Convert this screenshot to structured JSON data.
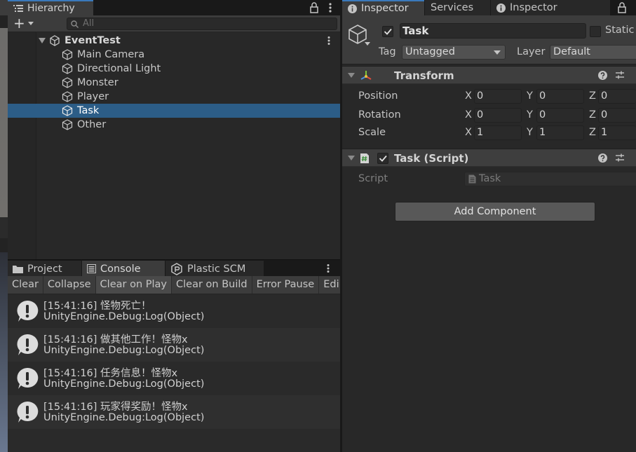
{
  "hierarchy": {
    "tab_title": "Hierarchy",
    "add_button": "+",
    "search_placeholder": "All",
    "scene_name": "EventTest",
    "objects": [
      {
        "name": "Main Camera"
      },
      {
        "name": "Directional Light"
      },
      {
        "name": "Monster"
      },
      {
        "name": "Player"
      },
      {
        "name": "Task",
        "selected": true
      },
      {
        "name": "Other"
      }
    ]
  },
  "console": {
    "tabs": [
      "Project",
      "Console",
      "Plastic SCM"
    ],
    "active_tab": "Console",
    "toolbar": [
      "Clear",
      "Collapse",
      "Clear on Play",
      "Clear on Build",
      "Error Pause",
      "Edi"
    ],
    "toolbar_active": "Clear on Play",
    "logs": [
      {
        "line1": "[15:41:16] 怪物死亡！",
        "line2": "UnityEngine.Debug:Log(Object)"
      },
      {
        "line1": "[15:41:16] 做其他工作！怪物x",
        "line2": "UnityEngine.Debug:Log(Object)"
      },
      {
        "line1": "[15:41:16] 任务信息！怪物x",
        "line2": "UnityEngine.Debug:Log(Object)"
      },
      {
        "line1": "[15:41:16] 玩家得奖励！怪物x",
        "line2": "UnityEngine.Debug:Log(Object)"
      }
    ]
  },
  "inspector": {
    "tabs": [
      "Inspector",
      "Services",
      "Inspector"
    ],
    "object_name": "Task",
    "active": true,
    "static_label": "Static",
    "tag_label": "Tag",
    "tag_value": "Untagged",
    "layer_label": "Layer",
    "layer_value": "Default",
    "transform": {
      "title": "Transform",
      "rows": [
        {
          "label": "Position",
          "x": "0",
          "y": "0",
          "z": "0"
        },
        {
          "label": "Rotation",
          "x": "0",
          "y": "0",
          "z": "0"
        },
        {
          "label": "Scale",
          "x": "1",
          "y": "1",
          "z": "1"
        }
      ],
      "axis_labels": [
        "X",
        "Y",
        "Z"
      ]
    },
    "script_component": {
      "title": "Task (Script)",
      "enabled": true,
      "script_label": "Script",
      "script_value": "Task"
    },
    "add_component": "Add Component"
  },
  "colors": {
    "selection": "#2c5d87",
    "tab_accent": "#3a79bb",
    "panel_bg": "#282828",
    "toolbar_bg": "#3c3c3c"
  }
}
